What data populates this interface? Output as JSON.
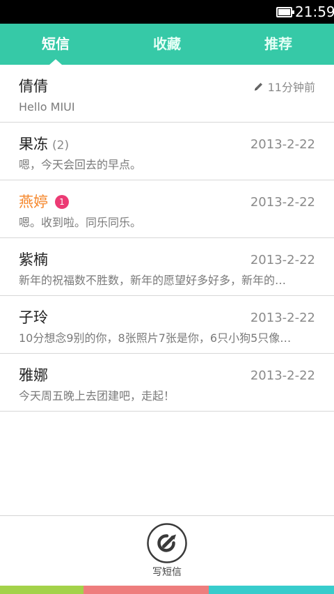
{
  "status_bar": {
    "time": "21:59",
    "battery_icon": "battery-full-icon"
  },
  "tabs": [
    {
      "label": "短信",
      "active": true
    },
    {
      "label": "收藏",
      "active": false
    },
    {
      "label": "推荐",
      "active": false
    }
  ],
  "conversations": [
    {
      "name": "倩倩",
      "count": "",
      "badge": "",
      "time": "11分钟前",
      "draft_icon": "pencil-icon",
      "preview": "Hello MIUI",
      "unread": false
    },
    {
      "name": "果冻",
      "count": "(2)",
      "badge": "",
      "time": "2013-2-22",
      "preview": "嗯，今天会回去的早点。",
      "unread": false
    },
    {
      "name": "燕婷",
      "count": "",
      "badge": "1",
      "time": "2013-2-22",
      "preview": "嗯。收到啦。同乐同乐。",
      "unread": true
    },
    {
      "name": "紫楠",
      "count": "",
      "badge": "",
      "time": "2013-2-22",
      "preview": "新年的祝福数不胜数，新年的愿望好多好多，新年的…",
      "unread": false
    },
    {
      "name": "子玲",
      "count": "",
      "badge": "",
      "time": "2013-2-22",
      "preview": "10分想念9别的你，8张照片7张是你，6只小狗5只像…",
      "unread": false
    },
    {
      "name": "雅娜",
      "count": "",
      "badge": "",
      "time": "2013-2-22",
      "preview": "今天周五晚上去团建吧，走起！",
      "unread": false
    }
  ],
  "compose": {
    "label": "写短信",
    "icon": "compose-icon"
  },
  "colors": {
    "accent": "#36c9a7",
    "unread_name": "#f5862a",
    "badge": "#ec3b74",
    "strip": [
      "#a3d24a",
      "#ee7d7d",
      "#38cccc"
    ]
  }
}
